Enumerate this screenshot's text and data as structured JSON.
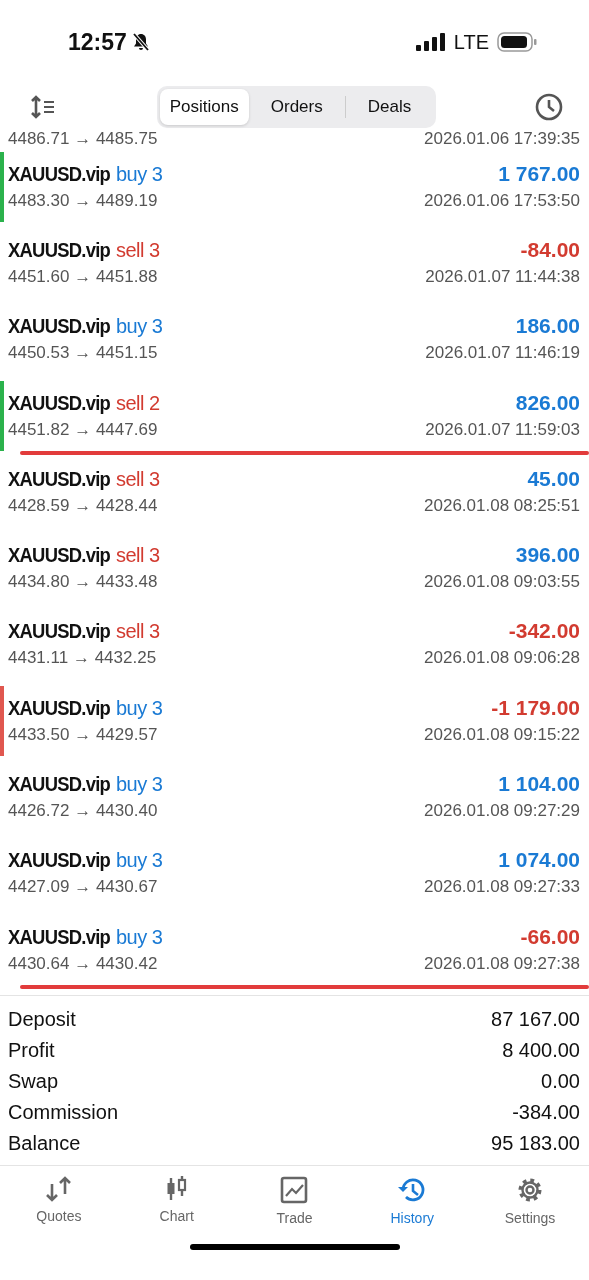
{
  "status_bar": {
    "time": "12:57",
    "network": "LTE"
  },
  "tabs": [
    {
      "label": "Positions",
      "selected": true
    },
    {
      "label": "Orders",
      "selected": false
    },
    {
      "label": "Deals",
      "selected": false
    }
  ],
  "partial_row": {
    "prices": "4486.71 → 4485.75",
    "time": "2026.01.06 17:39:35"
  },
  "deals": [
    {
      "symbol": "XAUUSD.vip",
      "side": "buy",
      "volume": "3",
      "profit": "1 767.00",
      "kind": "gain",
      "prices": "4483.30 → 4489.19",
      "time": "2026.01.06 17:53:50",
      "color": "#2bb24c",
      "underlined": false
    },
    {
      "symbol": "XAUUSD.vip",
      "side": "sell",
      "volume": "3",
      "profit": "-84.00",
      "kind": "loss",
      "prices": "4451.60 → 4451.88",
      "time": "2026.01.07 11:44:38",
      "underlined": false
    },
    {
      "symbol": "XAUUSD.vip",
      "side": "buy",
      "volume": "3",
      "profit": "186.00",
      "kind": "gain",
      "prices": "4450.53 → 4451.15",
      "time": "2026.01.07 11:46:19",
      "underlined": false
    },
    {
      "symbol": "XAUUSD.vip",
      "side": "sell",
      "volume": "2",
      "profit": "826.00",
      "kind": "gain",
      "prices": "4451.82 → 4447.69",
      "time": "2026.01.07 11:59:03",
      "color": "#2bb24c",
      "underlined": true
    },
    {
      "symbol": "XAUUSD.vip",
      "side": "sell",
      "volume": "3",
      "profit": "45.00",
      "kind": "gain",
      "prices": "4428.59 → 4428.44",
      "time": "2026.01.08 08:25:51",
      "underlined": false
    },
    {
      "symbol": "XAUUSD.vip",
      "side": "sell",
      "volume": "3",
      "profit": "396.00",
      "kind": "gain",
      "prices": "4434.80 → 4433.48",
      "time": "2026.01.08 09:03:55",
      "underlined": false
    },
    {
      "symbol": "XAUUSD.vip",
      "side": "sell",
      "volume": "3",
      "profit": "-342.00",
      "kind": "loss",
      "prices": "4431.11 → 4432.25",
      "time": "2026.01.08 09:06:28",
      "underlined": false
    },
    {
      "symbol": "XAUUSD.vip",
      "side": "buy",
      "volume": "3",
      "profit": "-1 179.00",
      "kind": "loss",
      "prices": "4433.50 → 4429.57",
      "time": "2026.01.08 09:15:22",
      "color": "#e0574f",
      "underlined": false
    },
    {
      "symbol": "XAUUSD.vip",
      "side": "buy",
      "volume": "3",
      "profit": "1 104.00",
      "kind": "gain",
      "prices": "4426.72 → 4430.40",
      "time": "2026.01.08 09:27:29",
      "underlined": false
    },
    {
      "symbol": "XAUUSD.vip",
      "side": "buy",
      "volume": "3",
      "profit": "1 074.00",
      "kind": "gain",
      "prices": "4427.09 → 4430.67",
      "time": "2026.01.08 09:27:33",
      "underlined": false
    },
    {
      "symbol": "XAUUSD.vip",
      "side": "buy",
      "volume": "3",
      "profit": "-66.00",
      "kind": "loss",
      "prices": "4430.64 → 4430.42",
      "time": "2026.01.08 09:27:38",
      "underlined": true
    }
  ],
  "summary": [
    {
      "label": "Deposit",
      "value": "87 167.00"
    },
    {
      "label": "Profit",
      "value": "8 400.00"
    },
    {
      "label": "Swap",
      "value": "0.00"
    },
    {
      "label": "Commission",
      "value": "-384.00"
    },
    {
      "label": "Balance",
      "value": "95 183.00"
    }
  ],
  "nav": [
    {
      "kind": "quotes",
      "label": "Quotes",
      "selected": false
    },
    {
      "kind": "chart",
      "label": "Chart",
      "selected": false
    },
    {
      "kind": "trade",
      "label": "Trade",
      "selected": false
    },
    {
      "kind": "history",
      "label": "History",
      "selected": true
    },
    {
      "kind": "settings",
      "label": "Settings",
      "selected": false
    }
  ]
}
